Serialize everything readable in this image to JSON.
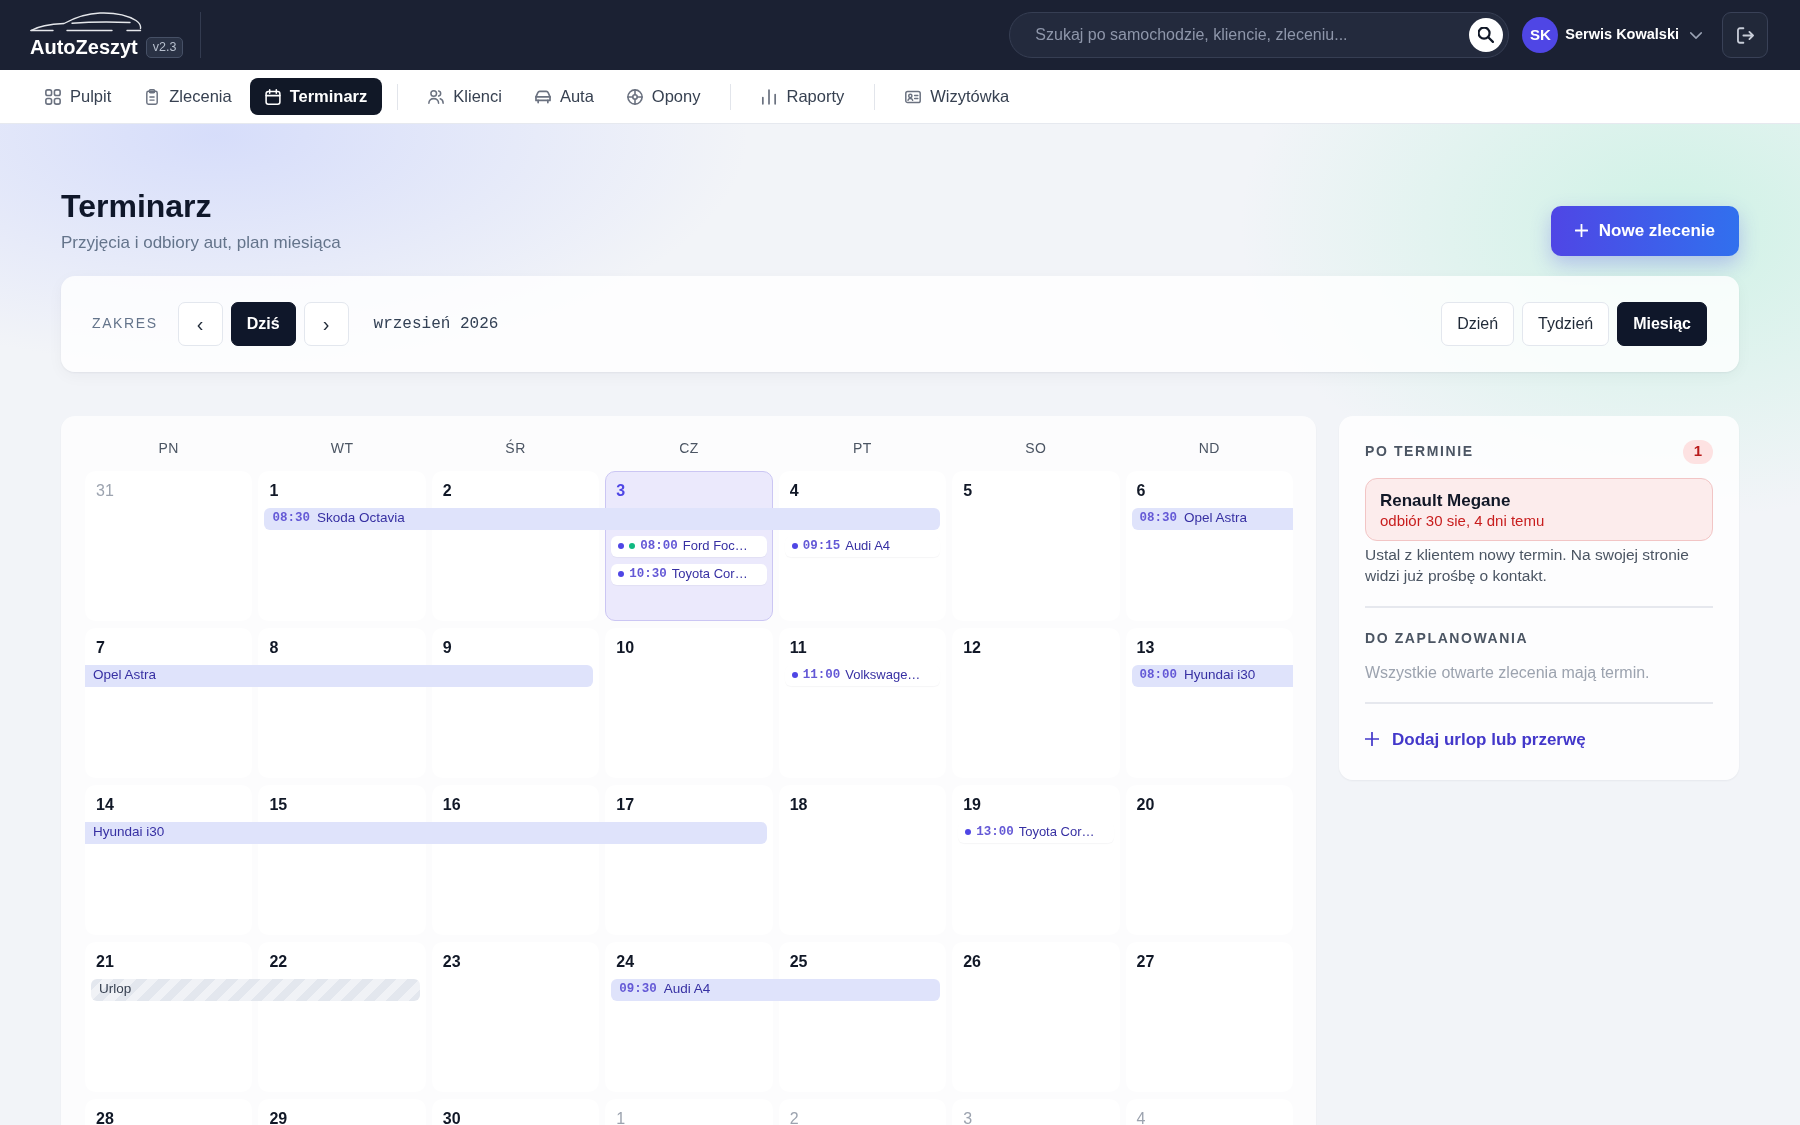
{
  "header": {
    "logo": "AutoZeszyt",
    "version": "v2.3",
    "search": {
      "placeholder": "Szukaj po samochodzie, kliencie, zleceniu..."
    },
    "user": {
      "initials": "SK",
      "name": "Serwis Kowalski"
    }
  },
  "nav": [
    [
      {
        "label": "Pulpit",
        "selected": false
      },
      {
        "label": "Zlecenia",
        "selected": false
      },
      {
        "label": "Terminarz",
        "selected": true
      }
    ],
    [
      {
        "label": "Klienci",
        "selected": false
      },
      {
        "label": "Auta",
        "selected": false
      },
      {
        "label": "Opony",
        "selected": false
      }
    ],
    [
      {
        "label": "Raporty",
        "selected": false
      }
    ],
    [
      {
        "label": "Wizytówka",
        "selected": false
      }
    ]
  ],
  "page": {
    "title": "Terminarz",
    "subtitle": "Przyjęcia i odbiory aut, plan miesiąca",
    "new_button": "Nowe zlecenie"
  },
  "toolbar": {
    "label": "ZAKRES",
    "previous": "‹",
    "today": "Dziś",
    "next": "›",
    "period": "wrzesień 2026",
    "views": [
      {
        "label": "Dzień",
        "selected": false
      },
      {
        "label": "Tydzień",
        "selected": false
      },
      {
        "label": "Miesiąc",
        "selected": true
      }
    ]
  },
  "calendar": {
    "weekdays": [
      "PN",
      "WT",
      "ŚR",
      "CZ",
      "PT",
      "SO",
      "ND"
    ],
    "weeks": [
      {
        "groups": [
          {
            "days": [
              {
                "number": "31",
                "in_month": false,
                "today": false
              }
            ]
          },
          {
            "bar": {
              "kind": "booking",
              "continues_before": false,
              "continues_after": false,
              "time": "08:30",
              "title": "Skoda Octavia"
            },
            "days": [
              {
                "number": "1",
                "in_month": true,
                "today": false
              },
              {
                "number": "2",
                "in_month": true,
                "today": false
              },
              {
                "number": "3",
                "in_month": true,
                "today": true,
                "appointments": [
                  {
                    "dots": [
                      {
                        "color": "#4f46e5"
                      },
                      {
                        "color": "#10b981"
                      }
                    ],
                    "time": "08:00",
                    "title": "Ford Foc…"
                  },
                  {
                    "dots": [
                      {
                        "color": "#4f46e5"
                      }
                    ],
                    "time": "10:30",
                    "title": "Toyota Cor…"
                  }
                ]
              },
              {
                "number": "4",
                "in_month": true,
                "today": false,
                "appointments": [
                  {
                    "dots": [
                      {
                        "color": "#4f46e5"
                      }
                    ],
                    "time": "09:15",
                    "title": "Audi A4"
                  }
                ]
              }
            ]
          },
          {
            "days": [
              {
                "number": "5",
                "in_month": true,
                "today": false
              }
            ]
          },
          {
            "bar": {
              "kind": "booking",
              "continues_before": false,
              "continues_after": true,
              "time": "08:30",
              "title": "Opel Astra"
            },
            "days": [
              {
                "number": "6",
                "in_month": true,
                "today": false
              }
            ]
          }
        ]
      },
      {
        "groups": [
          {
            "bar": {
              "kind": "booking",
              "continues_before": true,
              "continues_after": false,
              "title": "Opel Astra"
            },
            "days": [
              {
                "number": "7",
                "in_month": true,
                "today": false
              },
              {
                "number": "8",
                "in_month": true,
                "today": false
              },
              {
                "number": "9",
                "in_month": true,
                "today": false
              }
            ]
          },
          {
            "days": [
              {
                "number": "10",
                "in_month": true,
                "today": false
              },
              {
                "number": "11",
                "in_month": true,
                "today": false,
                "appointments": [
                  {
                    "dots": [
                      {
                        "color": "#4f46e5"
                      }
                    ],
                    "time": "11:00",
                    "title": "Volkswage…"
                  }
                ]
              },
              {
                "number": "12",
                "in_month": true,
                "today": false
              }
            ]
          },
          {
            "bar": {
              "kind": "booking",
              "continues_before": false,
              "continues_after": true,
              "time": "08:00",
              "title": "Hyundai i30"
            },
            "days": [
              {
                "number": "13",
                "in_month": true,
                "today": false
              }
            ]
          }
        ]
      },
      {
        "groups": [
          {
            "bar": {
              "kind": "booking",
              "continues_before": true,
              "continues_after": false,
              "title": "Hyundai i30"
            },
            "days": [
              {
                "number": "14",
                "in_month": true,
                "today": false
              },
              {
                "number": "15",
                "in_month": true,
                "today": false
              },
              {
                "number": "16",
                "in_month": true,
                "today": false
              },
              {
                "number": "17",
                "in_month": true,
                "today": false
              }
            ]
          },
          {
            "days": [
              {
                "number": "18",
                "in_month": true,
                "today": false
              },
              {
                "number": "19",
                "in_month": true,
                "today": false,
                "appointments": [
                  {
                    "dots": [
                      {
                        "color": "#4f46e5"
                      }
                    ],
                    "time": "13:00",
                    "title": "Toyota Cor…"
                  }
                ]
              },
              {
                "number": "20",
                "in_month": true,
                "today": false
              }
            ]
          }
        ]
      },
      {
        "groups": [
          {
            "bar": {
              "kind": "leave",
              "continues_before": false,
              "continues_after": false,
              "title": "Urlop"
            },
            "days": [
              {
                "number": "21",
                "in_month": true,
                "today": false
              },
              {
                "number": "22",
                "in_month": true,
                "today": false
              }
            ]
          },
          {
            "days": [
              {
                "number": "23",
                "in_month": true,
                "today": false
              }
            ]
          },
          {
            "bar": {
              "kind": "booking",
              "continues_before": false,
              "continues_after": false,
              "time": "09:30",
              "title": "Audi A4"
            },
            "days": [
              {
                "number": "24",
                "in_month": true,
                "today": false
              },
              {
                "number": "25",
                "in_month": true,
                "today": false
              }
            ]
          },
          {
            "days": [
              {
                "number": "26",
                "in_month": true,
                "today": false
              },
              {
                "number": "27",
                "in_month": true,
                "today": false
              }
            ]
          }
        ]
      },
      {
        "groups": [
          {
            "days": [
              {
                "number": "28",
                "in_month": true,
                "today": false
              },
              {
                "number": "29",
                "in_month": true,
                "today": false
              },
              {
                "number": "30",
                "in_month": true,
                "today": false
              },
              {
                "number": "1",
                "in_month": false,
                "today": false
              },
              {
                "number": "2",
                "in_month": false,
                "today": false
              },
              {
                "number": "3",
                "in_month": false,
                "today": false
              },
              {
                "number": "4",
                "in_month": false,
                "today": false
              }
            ]
          }
        ]
      }
    ]
  },
  "sidebar": {
    "overdue": {
      "heading": "PO TERMINIE",
      "count": "1",
      "items": [
        {
          "title": "Renault Megane",
          "detail": "odbiór 30 sie, 4 dni temu"
        }
      ],
      "note": "Ustal z klientem nowy termin. Na swojej stronie widzi już prośbę o kontakt."
    },
    "unscheduled": {
      "heading": "DO ZAPLANOWANIA",
      "empty_text": "Wszystkie otwarte zlecenia mają termin."
    },
    "add_link": "Dodaj urlop lub przerwę"
  }
}
